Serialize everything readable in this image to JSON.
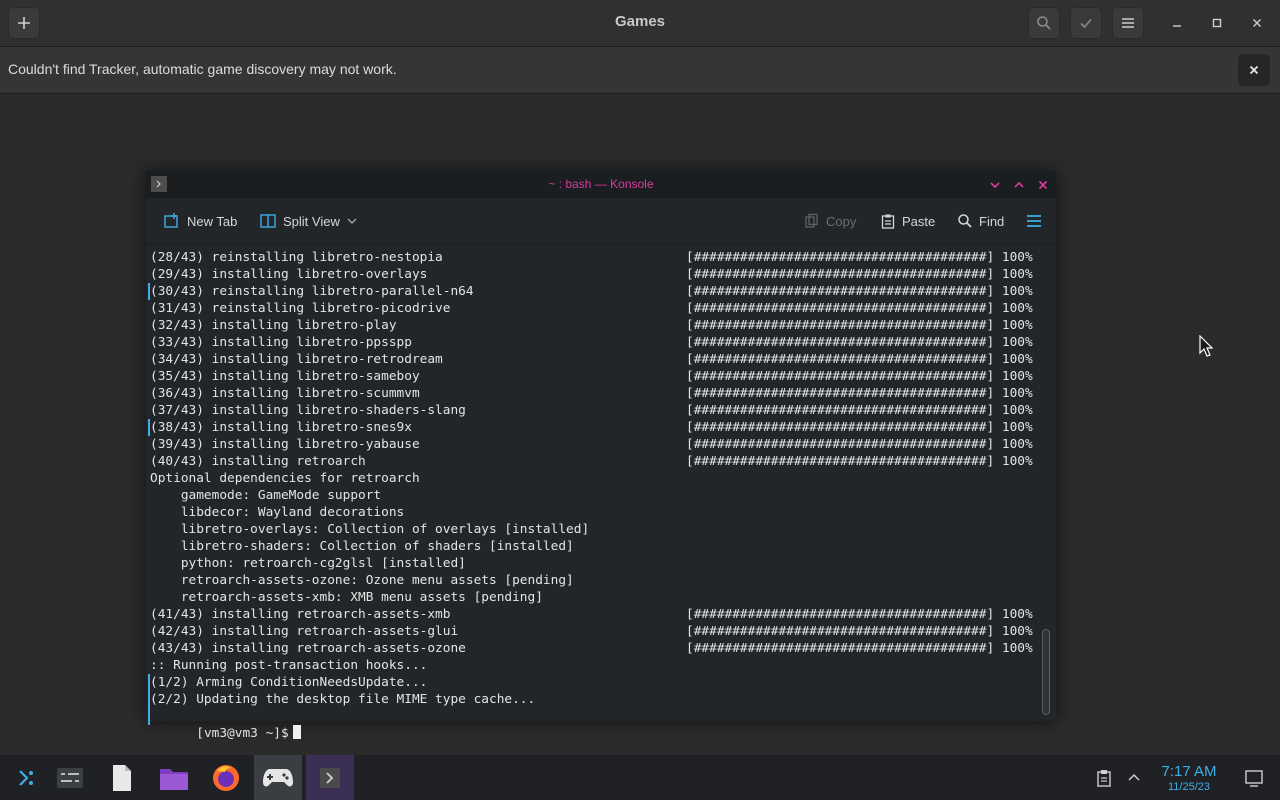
{
  "games": {
    "title": "Games",
    "info_message": "Couldn't find Tracker, automatic game discovery may not work."
  },
  "konsole": {
    "title": "~ : bash — Konsole",
    "toolbar": {
      "new_tab": "New Tab",
      "split_view": "Split View",
      "copy": "Copy",
      "paste": "Paste",
      "find": "Find"
    },
    "lines": [
      {
        "text": "(28/43) reinstalling libretro-nestopia",
        "progress": "[######################################] 100%"
      },
      {
        "text": "(29/43) installing libretro-overlays",
        "progress": "[######################################] 100%"
      },
      {
        "text": "(30/43) reinstalling libretro-parallel-n64",
        "progress": "[######################################] 100%"
      },
      {
        "text": "(31/43) reinstalling libretro-picodrive",
        "progress": "[######################################] 100%"
      },
      {
        "text": "(32/43) installing libretro-play",
        "progress": "[######################################] 100%"
      },
      {
        "text": "(33/43) installing libretro-ppsspp",
        "progress": "[######################################] 100%"
      },
      {
        "text": "(34/43) installing libretro-retrodream",
        "progress": "[######################################] 100%"
      },
      {
        "text": "(35/43) installing libretro-sameboy",
        "progress": "[######################################] 100%"
      },
      {
        "text": "(36/43) installing libretro-scummvm",
        "progress": "[######################################] 100%"
      },
      {
        "text": "(37/43) installing libretro-shaders-slang",
        "progress": "[######################################] 100%"
      },
      {
        "text": "(38/43) installing libretro-snes9x",
        "progress": "[######################################] 100%"
      },
      {
        "text": "(39/43) installing libretro-yabause",
        "progress": "[######################################] 100%"
      },
      {
        "text": "(40/43) installing retroarch",
        "progress": "[######################################] 100%"
      },
      {
        "text": "Optional dependencies for retroarch",
        "progress": ""
      },
      {
        "text": "    gamemode: GameMode support",
        "progress": ""
      },
      {
        "text": "    libdecor: Wayland decorations",
        "progress": ""
      },
      {
        "text": "    libretro-overlays: Collection of overlays [installed]",
        "progress": ""
      },
      {
        "text": "    libretro-shaders: Collection of shaders [installed]",
        "progress": ""
      },
      {
        "text": "    python: retroarch-cg2glsl [installed]",
        "progress": ""
      },
      {
        "text": "    retroarch-assets-ozone: Ozone menu assets [pending]",
        "progress": ""
      },
      {
        "text": "    retroarch-assets-xmb: XMB menu assets [pending]",
        "progress": ""
      },
      {
        "text": "(41/43) installing retroarch-assets-xmb",
        "progress": "[######################################] 100%"
      },
      {
        "text": "(42/43) installing retroarch-assets-glui",
        "progress": "[######################################] 100%"
      },
      {
        "text": "(43/43) installing retroarch-assets-ozone",
        "progress": "[######################################] 100%"
      },
      {
        "text": ":: Running post-transaction hooks...",
        "progress": ""
      },
      {
        "text": "(1/2) Arming ConditionNeedsUpdate...",
        "progress": ""
      },
      {
        "text": "(2/2) Updating the desktop file MIME type cache...",
        "progress": ""
      }
    ],
    "prompt": "[vm3@vm3 ~]$"
  },
  "taskbar": {
    "time": "7:17 AM",
    "date": "11/25/23"
  },
  "colors": {
    "accent": "#3daee9",
    "konsole_title": "#d63ba1"
  }
}
